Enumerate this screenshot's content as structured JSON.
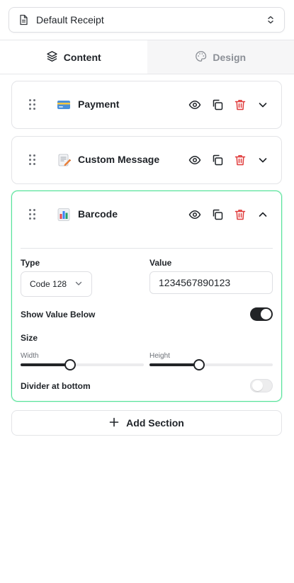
{
  "template_select": {
    "value": "Default Receipt",
    "icon": "document-icon"
  },
  "tabs": [
    {
      "label": "Content",
      "icon": "layers-icon",
      "active": true
    },
    {
      "label": "Design",
      "icon": "palette-icon",
      "active": false
    }
  ],
  "sections": [
    {
      "title": "Payment",
      "icon": "credit-card-icon",
      "expanded": false
    },
    {
      "title": "Custom Message",
      "icon": "memo-icon",
      "expanded": false
    },
    {
      "title": "Barcode",
      "icon": "bar-chart-icon",
      "expanded": true
    }
  ],
  "barcode": {
    "type_label": "Type",
    "type_value": "Code 128",
    "value_label": "Value",
    "value": "1234567890123",
    "show_value_below_label": "Show Value Below",
    "show_value_below": true,
    "size_label": "Size",
    "width_label": "Width",
    "width_value": 0.4,
    "height_label": "Height",
    "height_value": 0.4,
    "divider_label": "Divider at bottom",
    "divider_at_bottom": false
  },
  "add_section_label": "Add Section",
  "colors": {
    "accent_border": "#57e39a",
    "delete": "#e03b3b",
    "toggle_on": "#222427"
  }
}
